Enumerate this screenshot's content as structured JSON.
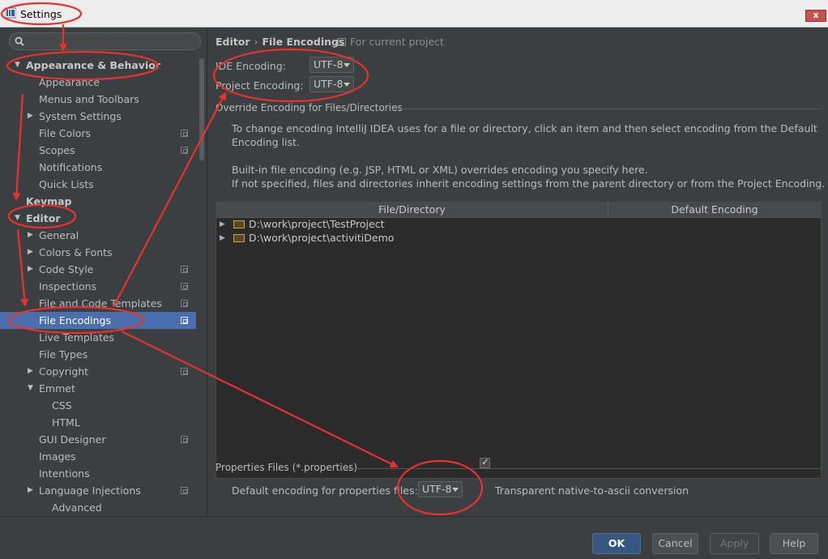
{
  "window": {
    "title": "Settings",
    "close_symbol": "x"
  },
  "search": {
    "value": "",
    "placeholder": ""
  },
  "tree": [
    {
      "label": "Appearance & Behavior",
      "level": 0,
      "expanded": true,
      "bold": true,
      "project_icon": false
    },
    {
      "label": "Appearance",
      "level": 1,
      "project_icon": false
    },
    {
      "label": "Menus and Toolbars",
      "level": 1,
      "project_icon": false
    },
    {
      "label": "System Settings",
      "level": 1,
      "collapsed": true,
      "project_icon": false
    },
    {
      "label": "File Colors",
      "level": 1,
      "project_icon": true
    },
    {
      "label": "Scopes",
      "level": 1,
      "project_icon": true
    },
    {
      "label": "Notifications",
      "level": 1,
      "project_icon": false
    },
    {
      "label": "Quick Lists",
      "level": 1,
      "project_icon": false
    },
    {
      "label": "Keymap",
      "level": 0,
      "bold": true,
      "project_icon": false
    },
    {
      "label": "Editor",
      "level": 0,
      "expanded": true,
      "bold": true,
      "project_icon": false
    },
    {
      "label": "General",
      "level": 1,
      "collapsed": true,
      "project_icon": false
    },
    {
      "label": "Colors & Fonts",
      "level": 1,
      "collapsed": true,
      "project_icon": false
    },
    {
      "label": "Code Style",
      "level": 1,
      "collapsed": true,
      "project_icon": true
    },
    {
      "label": "Inspections",
      "level": 1,
      "project_icon": true
    },
    {
      "label": "File and Code Templates",
      "level": 1,
      "project_icon": true
    },
    {
      "label": "File Encodings",
      "level": 1,
      "selected": true,
      "project_icon": true
    },
    {
      "label": "Live Templates",
      "level": 1,
      "project_icon": false
    },
    {
      "label": "File Types",
      "level": 1,
      "project_icon": false
    },
    {
      "label": "Copyright",
      "level": 1,
      "collapsed": true,
      "project_icon": true
    },
    {
      "label": "Emmet",
      "level": 1,
      "expanded": true,
      "project_icon": false
    },
    {
      "label": "CSS",
      "level": 2,
      "project_icon": false
    },
    {
      "label": "HTML",
      "level": 2,
      "project_icon": false
    },
    {
      "label": "GUI Designer",
      "level": 1,
      "project_icon": true
    },
    {
      "label": "Images",
      "level": 1,
      "project_icon": false
    },
    {
      "label": "Intentions",
      "level": 1,
      "project_icon": false
    },
    {
      "label": "Language Injections",
      "level": 1,
      "collapsed": true,
      "project_icon": true
    },
    {
      "label": "Advanced",
      "level": 2,
      "project_icon": false
    }
  ],
  "breadcrumb": {
    "parent": "Editor",
    "separator": "›",
    "current": "File Encodings",
    "scope": "For current project"
  },
  "ide_encoding": {
    "label": "IDE Encoding:",
    "value": "UTF-8"
  },
  "project_encoding": {
    "label": "Project Encoding:",
    "value": "UTF-8"
  },
  "override": {
    "title": "Override Encoding for Files/Directories",
    "desc1_line1": "To change encoding IntelliJ IDEA uses for a file or directory, click an item and then select encoding from the Default",
    "desc1_line2": "Encoding list.",
    "desc2_line1": "Built-in file encoding (e.g. JSP, HTML or XML) overrides encoding you specify here.",
    "desc2_line2": "If not specified, files and directories inherit encoding settings from the parent directory or from the Project Encoding."
  },
  "table": {
    "columns": [
      "File/Directory",
      "Default Encoding"
    ],
    "rows": [
      {
        "path": "D:\\work\\project\\TestProject",
        "encoding": ""
      },
      {
        "path": "D:\\work\\project\\activitiDemo",
        "encoding": ""
      }
    ]
  },
  "properties": {
    "title": "Properties Files (*.properties)",
    "label": "Default encoding for properties files:",
    "value": "UTF-8",
    "native_to_ascii_label": "Transparent native-to-ascii conversion",
    "native_to_ascii_checked": true
  },
  "buttons": {
    "ok": "OK",
    "cancel": "Cancel",
    "apply": "Apply",
    "help": "Help"
  },
  "colors": {
    "background": "#3c3f41",
    "selection": "#4b6eaf",
    "primary_button": "#365880",
    "annotation": "#e8322b"
  },
  "icons": {
    "search": "magnifier-icon",
    "app": "intellij-app-icon",
    "project_scope": "project-scope-icon",
    "folder": "folder-icon",
    "expand": "triangle-right-icon",
    "collapse": "triangle-down-icon"
  }
}
